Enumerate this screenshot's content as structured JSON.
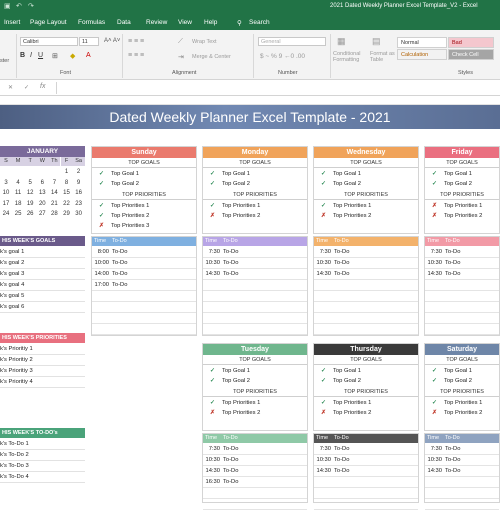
{
  "window": {
    "title": "2021 Dated Weekly Planner Excel Template_V2 - Excel"
  },
  "menu": [
    "Insert",
    "Page Layout",
    "Formulas",
    "Data",
    "Review",
    "View",
    "Help",
    "Search"
  ],
  "ribbon": {
    "font_name": "Calibri",
    "font_size": "11",
    "wrap_text": "Wrap Text",
    "merge_center": "Merge & Center",
    "number_format": "General",
    "conditional_formatting": "Conditional Formatting",
    "format_as_table": "Format as Table",
    "style_normal": "Normal",
    "style_bad": "Bad",
    "style_calculation": "Calculation",
    "style_check_cell": "Check Cell",
    "group_font": "Font",
    "group_alignment": "Alignment",
    "group_number": "Number",
    "group_styles": "Styles",
    "left_cut": "ster"
  },
  "banner_title": "Dated Weekly Planner Excel Template - 2021",
  "calendar": {
    "month": "JANUARY",
    "headers": [
      "S",
      "M",
      "T",
      "W",
      "Th",
      "F",
      "Sa"
    ],
    "rows": [
      [
        "",
        "",
        "",
        "",
        "",
        "1",
        "2"
      ],
      [
        "3",
        "4",
        "5",
        "6",
        "7",
        "8",
        "9"
      ],
      [
        "10",
        "11",
        "12",
        "13",
        "14",
        "15",
        "16"
      ],
      [
        "17",
        "18",
        "19",
        "20",
        "21",
        "22",
        "23"
      ],
      [
        "24",
        "25",
        "26",
        "27",
        "28",
        "29",
        "30"
      ]
    ]
  },
  "side": {
    "goals_title": "HIS WEEK'S GOALS",
    "goals": [
      "k's goal 1",
      "k's goal 2",
      "k's goal 3",
      "k's goal 4",
      "k's goal 5",
      "k's goal 6"
    ],
    "priorities_title": "HIS WEEK'S PRIORITIES",
    "priorities": [
      "k's Prioritiy 1",
      "k's Prioritiy 2",
      "k's Prioritiy 3",
      "k's Prioritiy 4"
    ],
    "todos_title": "HIS WEEK'S TO-DO's",
    "todos": [
      "k's To-Do 1",
      "k's To-Do 2",
      "k's To-Do 3",
      "k's To-Do 4"
    ]
  },
  "labels": {
    "top_goals": "TOP GOALS",
    "top_priorities": "TOP PRIORITIES",
    "time": "Time",
    "todo": "To-Do"
  },
  "days": [
    {
      "name": "Sunday",
      "color": "#ea7a6d",
      "goals": [
        "Top Goal 1",
        "Top Goal 2"
      ],
      "priorities": [
        "Top Priorities 1",
        "Top Priorities 2",
        "Top Priorities 3"
      ],
      "priority_marks": [
        "check",
        "check",
        "cross"
      ],
      "todo_color": "#7fb0e0",
      "times": [
        "8:00",
        "10:00",
        "14:00",
        "17:00"
      ],
      "todo_items": [
        "To-Do",
        "To-Do",
        "To-Do",
        "To-Do"
      ]
    },
    {
      "name": "Monday",
      "color": "#f0a35a",
      "goals": [
        "Top Goal 1",
        "Top Goal 2"
      ],
      "priorities": [
        "Top Priorities 1",
        "Top Priorities 2"
      ],
      "priority_marks": [
        "check",
        "cross"
      ],
      "todo_color": "#b8a5e6",
      "times": [
        "7:30",
        "10:30",
        "14:30"
      ],
      "todo_items": [
        "To-Do",
        "To-Do",
        "To-Do"
      ]
    },
    {
      "name": "Wednesday",
      "color": "#f0a35a",
      "goals": [
        "Top Goal 1",
        "Top Goal 2"
      ],
      "priorities": [
        "Top Priorities 1",
        "Top Priorities 2"
      ],
      "priority_marks": [
        "check",
        "cross"
      ],
      "todo_color": "#f3b26b",
      "times": [
        "7:30",
        "10:30",
        "14:30"
      ],
      "todo_items": [
        "To-Do",
        "To-Do",
        "To-Do"
      ]
    },
    {
      "name": "Friday",
      "color": "#ea6f80",
      "goals": [
        "Top Goal 1",
        "Top Goal 2"
      ],
      "priorities": [
        "Top Priorities 1",
        "Top Priorities 2"
      ],
      "priority_marks": [
        "cross",
        "cross"
      ],
      "todo_color": "#f29aa6",
      "times": [
        "7:30",
        "10:30",
        "14:30"
      ],
      "todo_items": [
        "To-Do",
        "To-Do",
        "To-Do"
      ]
    },
    {
      "name": "Tuesday",
      "color": "#6fb68d",
      "goals": [
        "Top Goal 1",
        "Top Goal 2"
      ],
      "priorities": [
        "Top Priorities 1",
        "Top Priorities 2"
      ],
      "priority_marks": [
        "check",
        "cross"
      ],
      "todo_color": "#8fc9a7",
      "times": [
        "7:30",
        "10:30",
        "14:30",
        "16:30"
      ],
      "todo_items": [
        "To-Do",
        "To-Do",
        "To-Do",
        "To-Do"
      ]
    },
    {
      "name": "Thursday",
      "color": "#3a3a3a",
      "goals": [
        "Top Goal 1",
        "Top Goal 2"
      ],
      "priorities": [
        "Top Priorities 1",
        "Top Priorities 2"
      ],
      "priority_marks": [
        "check",
        "cross"
      ],
      "todo_color": "#555555",
      "times": [
        "7:30",
        "10:30",
        "14:30"
      ],
      "todo_items": [
        "To-Do",
        "To-Do",
        "To-Do"
      ]
    },
    {
      "name": "Saturday",
      "color": "#6e86a8",
      "goals": [
        "Top Goal 1",
        "Top Goal 2"
      ],
      "priorities": [
        "Top Priorities 1",
        "Top Priorities 2"
      ],
      "priority_marks": [
        "check",
        "cross"
      ],
      "todo_color": "#8fa3c0",
      "times": [
        "7:30",
        "10:30",
        "14:30"
      ],
      "todo_items": [
        "To-Do",
        "To-Do",
        "To-Do"
      ]
    }
  ]
}
